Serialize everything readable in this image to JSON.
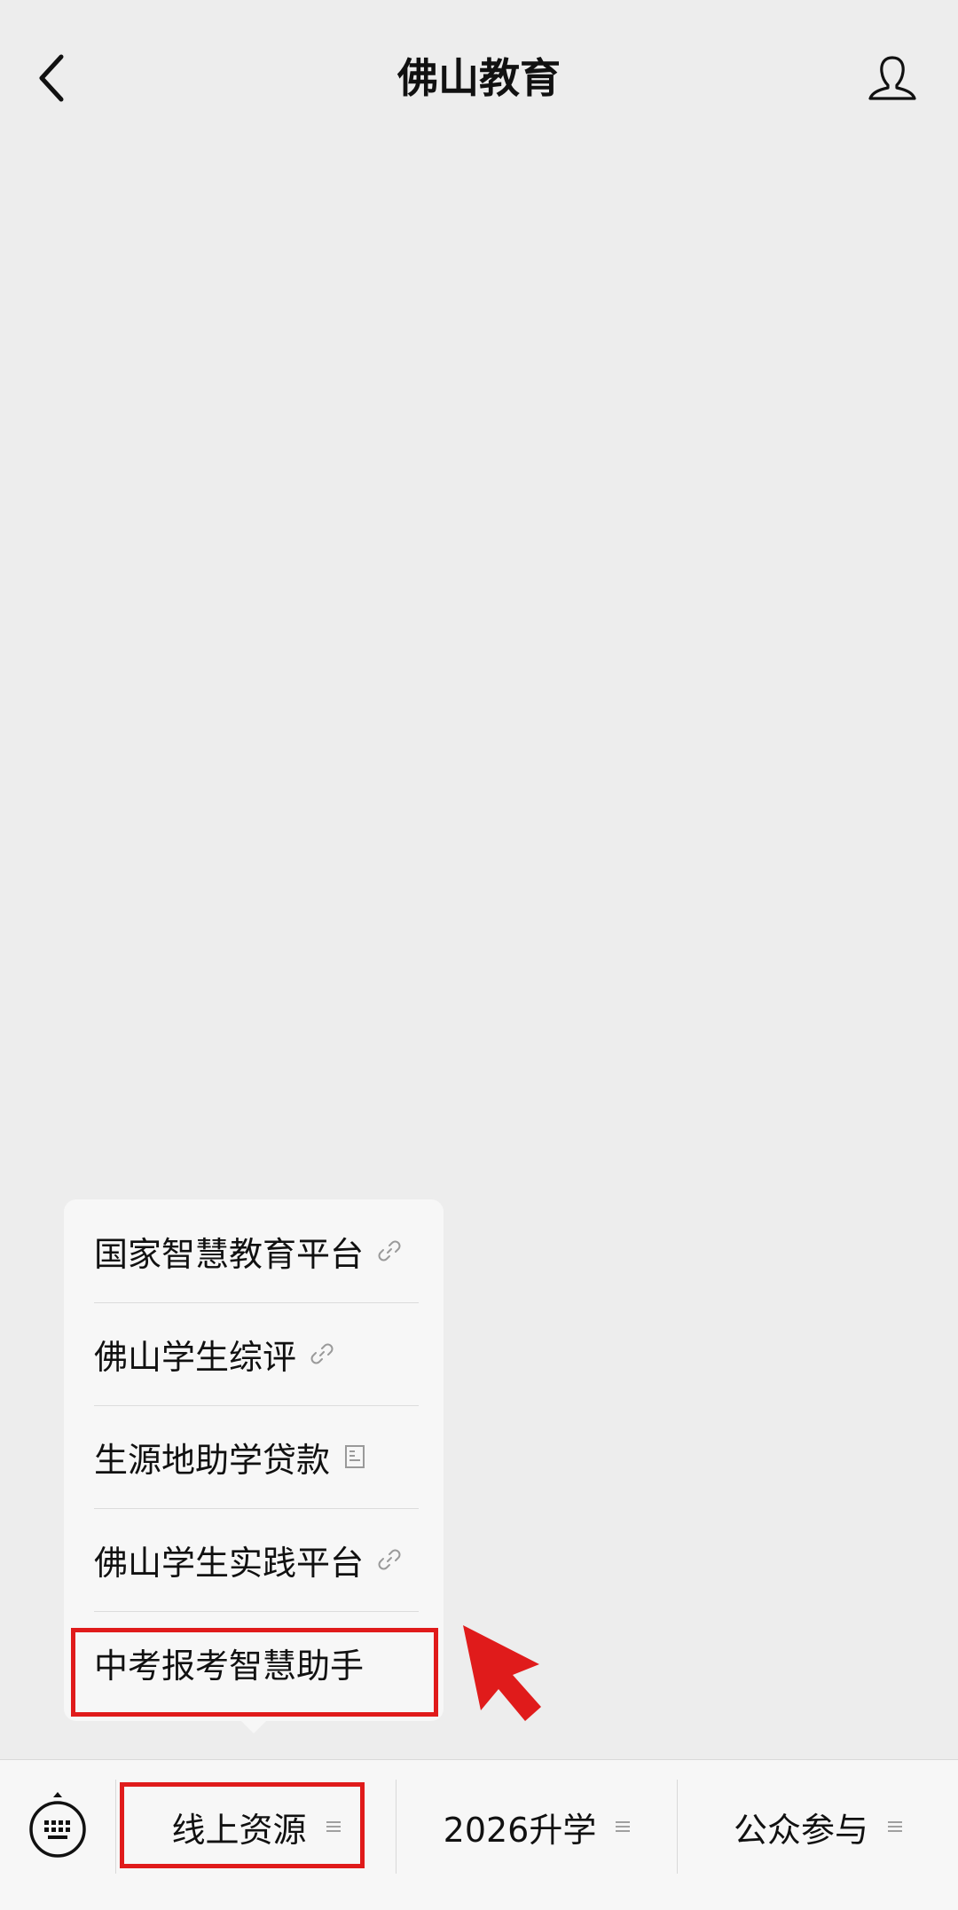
{
  "header": {
    "title": "佛山教育",
    "back_icon": "chevron-left-icon",
    "profile_icon": "user-profile-icon"
  },
  "submenu": {
    "items": [
      {
        "label": "国家智慧教育平台",
        "icon": "link-icon"
      },
      {
        "label": "佛山学生综评",
        "icon": "link-icon"
      },
      {
        "label": "生源地助学贷款",
        "icon": "article-icon"
      },
      {
        "label": "佛山学生实践平台",
        "icon": "link-icon"
      },
      {
        "label": "中考报考智慧助手",
        "icon": ""
      }
    ]
  },
  "bottom_menu": {
    "keyboard_icon": "keyboard-icon",
    "tabs": [
      {
        "label": "线上资源",
        "icon": "menu-lines-icon"
      },
      {
        "label": "2026升学",
        "icon": "menu-lines-icon"
      },
      {
        "label": "公众参与",
        "icon": "menu-lines-icon"
      }
    ]
  },
  "annotation": {
    "highlight_color": "#e01b1b"
  }
}
